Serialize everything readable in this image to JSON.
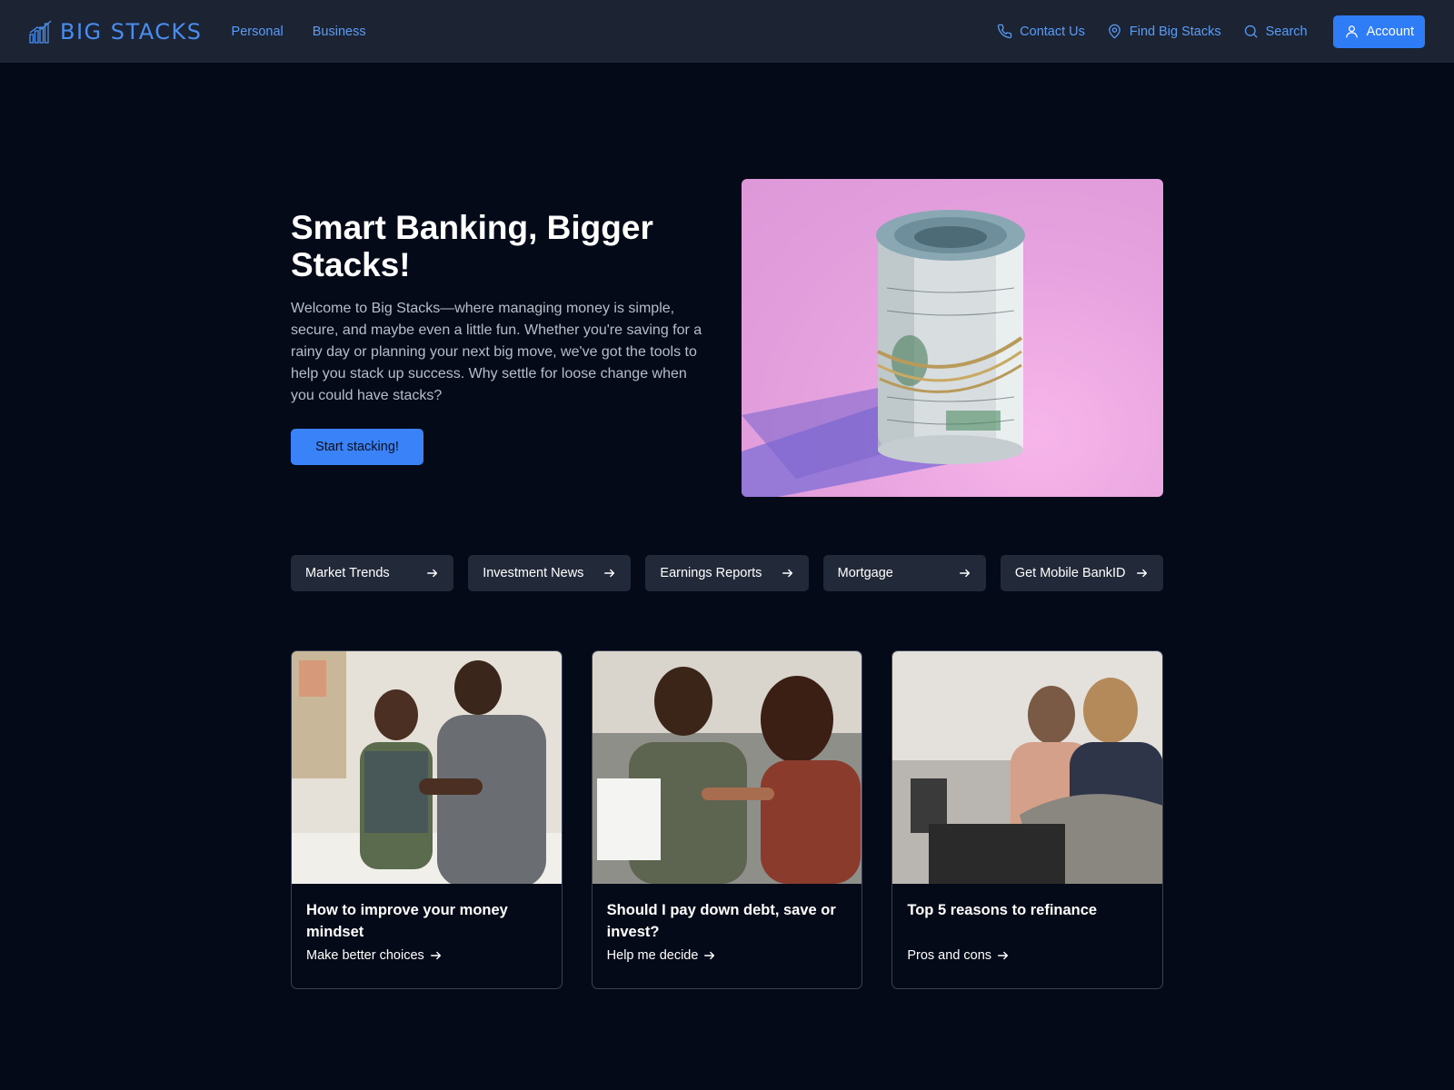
{
  "header": {
    "brand": "BIG STACKS",
    "nav_left": [
      {
        "label": "Personal"
      },
      {
        "label": "Business"
      }
    ],
    "nav_right": [
      {
        "label": "Contact Us",
        "icon": "phone-icon"
      },
      {
        "label": "Find Big Stacks",
        "icon": "map-pin-icon"
      },
      {
        "label": "Search",
        "icon": "search-icon"
      }
    ],
    "account_label": "Account"
  },
  "hero": {
    "title": "Smart Banking, Bigger Stacks!",
    "text": "Welcome to Big Stacks—where managing money is simple, secure, and maybe even a little fun. Whether you're saving for a rainy day or planning your next big move, we've got the tools to help you stack up success. Why settle for loose change when you could have stacks?",
    "cta_label": "Start stacking!"
  },
  "quick_links": [
    {
      "label": "Market Trends"
    },
    {
      "label": "Investment News"
    },
    {
      "label": "Earnings Reports"
    },
    {
      "label": "Mortgage"
    },
    {
      "label": "Get Mobile BankID"
    }
  ],
  "cards": [
    {
      "title": "How to improve your money mindset",
      "link": "Make better choices"
    },
    {
      "title": "Should I pay down debt, save or invest?",
      "link": "Help me decide"
    },
    {
      "title": "Top 5 reasons to refinance",
      "link": "Pros and cons"
    }
  ],
  "colors": {
    "background": "#050a18",
    "header": "#1c2434",
    "accent": "#2f7df6",
    "link": "#5b9cf5",
    "hero_image_bg": "#e7a3df"
  }
}
